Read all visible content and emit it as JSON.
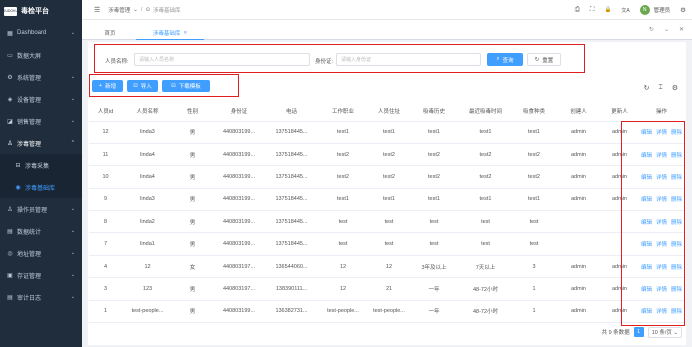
{
  "app": {
    "logo_text": "SUDOKU",
    "title": "毒检平台"
  },
  "sidebar": {
    "items": [
      {
        "label": "Dashboard",
        "icon": "dashboard-icon",
        "glyph": "▦",
        "chevron": "⌄"
      },
      {
        "label": "数据大屏",
        "icon": "monitor-icon",
        "glyph": "▭",
        "chevron": ""
      },
      {
        "label": "系统管理",
        "icon": "gear-icon",
        "glyph": "⚙",
        "chevron": "⌄"
      },
      {
        "label": "设备管理",
        "icon": "device-icon",
        "glyph": "◈",
        "chevron": "⌄"
      },
      {
        "label": "销售管理",
        "icon": "cart-icon",
        "glyph": "◪",
        "chevron": "⌄"
      },
      {
        "label": "涉毒管理",
        "icon": "user-icon",
        "glyph": "♙",
        "chevron": "⌃"
      },
      {
        "label": "涉毒采集",
        "icon": "collect-icon",
        "glyph": "⊟",
        "chevron": ""
      },
      {
        "label": "涉毒基础库",
        "icon": "database-icon",
        "glyph": "◉",
        "chevron": ""
      },
      {
        "label": "操作员管理",
        "icon": "operator-icon",
        "glyph": "♙",
        "chevron": "⌄"
      },
      {
        "label": "数据统计",
        "icon": "stats-icon",
        "glyph": "▤",
        "chevron": "⌄"
      },
      {
        "label": "地址管理",
        "icon": "location-icon",
        "glyph": "◎",
        "chevron": "⌄"
      },
      {
        "label": "存证管理",
        "icon": "archive-icon",
        "glyph": "▣",
        "chevron": "⌄"
      },
      {
        "label": "审计日志",
        "icon": "log-icon",
        "glyph": "▤",
        "chevron": "⌄"
      }
    ]
  },
  "navbar": {
    "breadcrumb": [
      "涉毒管理",
      "涉毒基础库"
    ],
    "hamburger": "☰",
    "chevron": "⌄",
    "separator": "/",
    "icons": {
      "doc": "⎙",
      "expand": "⛶",
      "lock": "🔒",
      "translate": "文A",
      "settings": "⚙"
    },
    "avatar_text": "N",
    "username": "管理员"
  },
  "tabs": {
    "items": [
      {
        "label": "首页"
      },
      {
        "label": "涉毒基础库"
      }
    ],
    "refresh_glyph": "↻",
    "more_glyph": "⌄",
    "close_glyph": "✕"
  },
  "search": {
    "name_label": "人员名称:",
    "name_placeholder": "请输入人员名称",
    "id_label": "身份证:",
    "id_placeholder": "请输入身份证",
    "search_button": "查询",
    "reset_button": "重置",
    "search_glyph": "⌕",
    "reset_glyph": "↻"
  },
  "toolbar": {
    "add_label": "新增",
    "import_label": "导入",
    "template_label": "下载模板",
    "add_glyph": "+",
    "import_glyph": "⊡",
    "template_glyph": "⊡",
    "tools": {
      "refresh": "↻",
      "column": "⌶",
      "settings": "⚙"
    }
  },
  "table": {
    "columns": [
      "人员id",
      "人员名称",
      "性别",
      "身份证",
      "电话",
      "工作职业",
      "人员住址",
      "吸毒历史",
      "最近吸毒时间",
      "吸食种类",
      "创建人",
      "更新人",
      "操作"
    ],
    "actions": [
      "编辑",
      "详情",
      "删除"
    ],
    "rows": [
      [
        "12",
        "linda3",
        "男",
        "440803199...",
        "137518445...",
        "test1",
        "test1",
        "test1",
        "test1",
        "test1",
        "admin",
        "admin"
      ],
      [
        "11",
        "linda4",
        "男",
        "440803199...",
        "137518445...",
        "test2",
        "test2",
        "test2",
        "test2",
        "test2",
        "admin",
        "admin"
      ],
      [
        "10",
        "linda4",
        "男",
        "440803199...",
        "137518445...",
        "test2",
        "test2",
        "test2",
        "test2",
        "test2",
        "admin",
        "admin"
      ],
      [
        "9",
        "linda3",
        "男",
        "440803199...",
        "137518445...",
        "test1",
        "test1",
        "test1",
        "test1",
        "test1",
        "admin",
        "admin"
      ],
      [
        "8",
        "linda2",
        "男",
        "440803199...",
        "137518445...",
        "test",
        "test",
        "test",
        "test",
        "test",
        "",
        ""
      ],
      [
        "7",
        "linda1",
        "男",
        "440803199...",
        "137518445...",
        "test",
        "test",
        "test",
        "test",
        "test",
        "",
        ""
      ],
      [
        "4",
        "12",
        "女",
        "440803197...",
        "136544060...",
        "12",
        "12",
        "3年及以上",
        "7天以上",
        "3",
        "admin",
        "admin"
      ],
      [
        "3",
        "123",
        "男",
        "440803197...",
        "138390111...",
        "12",
        "21",
        "一年",
        "48-72小时",
        "1",
        "admin",
        "admin"
      ],
      [
        "1",
        "test-people...",
        "男",
        "440803199...",
        "136382731...",
        "test-people...",
        "test-people...",
        "一年",
        "48-72小时",
        "1",
        "admin",
        "admin"
      ]
    ]
  },
  "pagination": {
    "total_text": "共 9 条数据",
    "current_page": "1",
    "page_size": "10 条/页 ⌄"
  },
  "colors": {
    "primary": "#409eff",
    "sidebar_bg": "#1f2d3d",
    "highlight_border": "#e02020"
  }
}
